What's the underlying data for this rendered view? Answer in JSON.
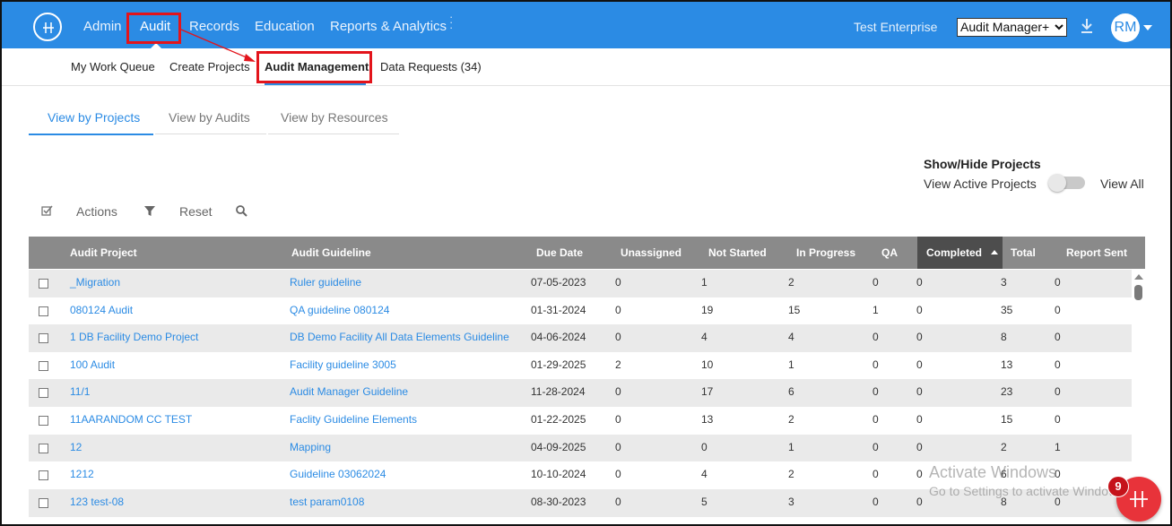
{
  "topbar": {
    "nav": [
      "Admin",
      "Audit",
      "Records",
      "Education",
      "Reports & Analytics"
    ],
    "enterprise": "Test Enterprise",
    "role_select": "Audit Manager+",
    "avatar": "RM",
    "colors": {
      "brand": "#2b8be4",
      "annotation": "#e3141b"
    }
  },
  "subnav": {
    "items": [
      "My Work Queue",
      "Create Projects",
      "Audit Management",
      "Data Requests (34)"
    ]
  },
  "view_tabs": [
    "View by Projects",
    "View by Audits",
    "View by Resources"
  ],
  "show_hide": {
    "title": "Show/Hide Projects",
    "left_label": "View Active Projects",
    "right_label": "View All"
  },
  "toolbar": {
    "actions": "Actions",
    "reset": "Reset"
  },
  "table": {
    "columns": [
      "Audit Project",
      "Audit Guideline",
      "Due Date",
      "Unassigned",
      "Not Started",
      "In Progress",
      "QA",
      "Completed",
      "Total",
      "Report Sent"
    ],
    "rows": [
      [
        "_Migration",
        "Ruler guideline",
        "07-05-2023",
        "0",
        "1",
        "2",
        "0",
        "0",
        "3",
        "0"
      ],
      [
        "080124 Audit",
        "QA guideline 080124",
        "01-31-2024",
        "0",
        "19",
        "15",
        "1",
        "0",
        "35",
        "0"
      ],
      [
        "1 DB Facility Demo Project",
        "DB Demo Facility All Data Elements Guideline",
        "04-06-2024",
        "0",
        "4",
        "4",
        "0",
        "0",
        "8",
        "0"
      ],
      [
        "100 Audit",
        "Facility guideline 3005",
        "01-29-2025",
        "2",
        "10",
        "1",
        "0",
        "0",
        "13",
        "0"
      ],
      [
        "11/1",
        "Audit Manager Guideline",
        "11-28-2024",
        "0",
        "17",
        "6",
        "0",
        "0",
        "23",
        "0"
      ],
      [
        "11AARANDOM CC TEST",
        "Faclity Guideline Elements",
        "01-22-2025",
        "0",
        "13",
        "2",
        "0",
        "0",
        "15",
        "0"
      ],
      [
        "12",
        "Mapping",
        "04-09-2025",
        "0",
        "0",
        "1",
        "0",
        "0",
        "2",
        "1"
      ],
      [
        "1212",
        "Guideline 03062024",
        "10-10-2024",
        "0",
        "4",
        "2",
        "0",
        "0",
        "6",
        "0"
      ],
      [
        "123 test-08",
        "test param0108",
        "08-30-2023",
        "0",
        "5",
        "3",
        "0",
        "0",
        "8",
        "0"
      ]
    ]
  },
  "watermark": {
    "line1": "Activate Windows",
    "line2": "Go to Settings to activate Windows."
  },
  "fab": {
    "badge": "9"
  }
}
